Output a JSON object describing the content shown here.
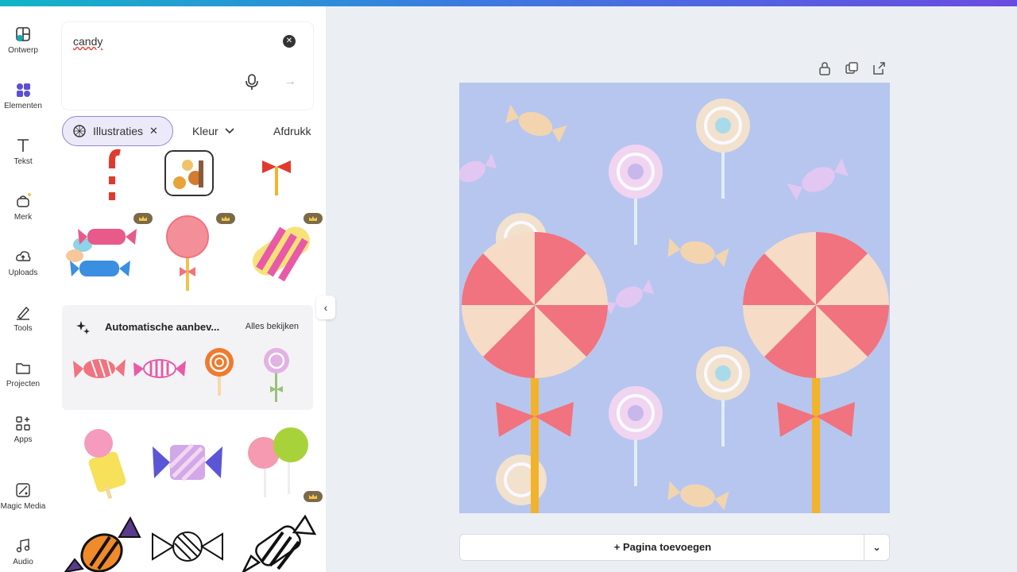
{
  "rail": {
    "items": [
      {
        "label": "Ontwerp",
        "icon": "layout-icon"
      },
      {
        "label": "Elementen",
        "icon": "elements-icon"
      },
      {
        "label": "Tekst",
        "icon": "text-icon"
      },
      {
        "label": "Merk",
        "icon": "brand-icon"
      },
      {
        "label": "Uploads",
        "icon": "upload-icon"
      },
      {
        "label": "Tools",
        "icon": "pen-icon"
      },
      {
        "label": "Projecten",
        "icon": "folder-icon"
      },
      {
        "label": "Apps",
        "icon": "apps-icon"
      },
      {
        "label": "Magic Media",
        "icon": "magic-media-icon"
      },
      {
        "label": "Audio",
        "icon": "music-icon"
      }
    ]
  },
  "search": {
    "query": "candy"
  },
  "filters": {
    "selected_chip": "Illustraties",
    "color_chip": "Kleur",
    "image_chip": "Afdrukk"
  },
  "auto_section": {
    "title": "Automatische aanbev...",
    "see_all": "Alles bekijken"
  },
  "canvas": {
    "add_page_label": "+ Pagina toevoegen",
    "background_color": "#b7c6ef"
  },
  "colors": {
    "accent": "#8e86d9",
    "candy_pink": "#f0737f",
    "candy_cream": "#f6dcc6",
    "stick_yellow": "#f2b32b"
  }
}
